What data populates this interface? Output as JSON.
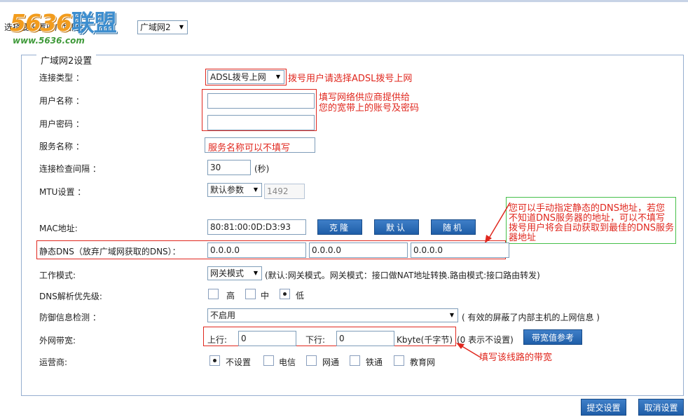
{
  "header": {
    "logo_text": "5636联盟",
    "logo_url": "www.5636.com",
    "select_label": "选择要设置的广域网：",
    "wan_select": "广域网2"
  },
  "section": {
    "title": "广域网2设置"
  },
  "fields": {
    "conn_type_label": "连接类型 ：",
    "conn_type_value": "ADSL拨号上网",
    "username_label": "用户名称 ：",
    "username_value": "",
    "password_label": "用户密码 ：",
    "password_value": "",
    "service_label": "服务名称 ：",
    "service_value": "",
    "interval_label": "连接检查间隔 ：",
    "interval_value": "30",
    "interval_unit": "(秒)",
    "mtu_label": "MTU设置 ：",
    "mtu_select": "默认参数",
    "mtu_value": "1492",
    "mac_label": "MAC地址:",
    "mac_value": "80:81:00:0D:D3:93",
    "btn_clone": "克隆",
    "btn_default": "默认",
    "btn_random": "随机",
    "dns_label": "静态DNS（放弃广域网获取的DNS）：",
    "dns1": "0.0.0.0",
    "dns2": "0.0.0.0",
    "dns3": "0.0.0.0",
    "mode_label": "工作模式:",
    "mode_select": "网关模式",
    "mode_note": "(默认:网关模式。网关模式：接口做NAT地址转换.路由模式:接口路由转发)",
    "dnspri_label": "DNS解析优先级:",
    "dnspri_options": [
      "高",
      "中",
      "低"
    ],
    "dnspri_selected": "低",
    "defense_label": "防御信息检测 ：",
    "defense_select": "不启用",
    "defense_note": "( 有效的屏蔽了内部主机的上网信息 )",
    "bw_label": "外网带宽:",
    "up_label": "上行:",
    "up_value": "0",
    "down_label": "下行:",
    "down_value": "0",
    "bw_unit": "Kbyte(千字节)",
    "bw_note": "(0 表示不设置)",
    "btn_bw_ref": "带宽值参考",
    "isp_label": "运营商:",
    "isp_options": [
      "不设置",
      "电信",
      "网通",
      "铁通",
      "教育网"
    ],
    "isp_selected": "不设置"
  },
  "annotations": {
    "conn_type": "拨号用户请选择ADSL拨号上网",
    "account_1": "填写网络供应商提供给",
    "account_2": "您的宽带上的账号及密码",
    "service": "服务名称可以不填写",
    "dns_1": "您可以手动指定静态的DNS地址，若您",
    "dns_2": "不知道DNS服务器的地址，可以不填写",
    "dns_3": "拨号用户将会自动获取到最佳的DNS服务",
    "dns_4": "器地址",
    "bandwidth": "填写该线路的带宽"
  },
  "footer": {
    "submit": "提交设置",
    "cancel": "取消设置"
  },
  "colors": {
    "annotation_red": "#e0271e",
    "button_blue": "#2a6bb8",
    "frame_blue": "#95aed0",
    "note_green": "#46c04a"
  }
}
